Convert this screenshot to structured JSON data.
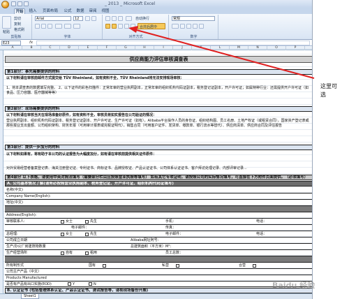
{
  "window": {
    "title": "_ 2013 _ Microsoft Excel"
  },
  "ribbon": {
    "tabs": [
      {
        "label": "开始"
      },
      {
        "label": "插入"
      },
      {
        "label": "页面布局"
      },
      {
        "label": "公式"
      },
      {
        "label": "数据"
      },
      {
        "label": "审阅"
      },
      {
        "label": "视图"
      }
    ],
    "paste_label": "粘贴",
    "cut_label": "剪切",
    "copy_label": "复制",
    "format_painter_label": "格式刷",
    "font_name": "Arial",
    "font_size": "12",
    "wrap_text_label": "自动换行",
    "merge_center_label": "合并后居中",
    "number_format": "常规",
    "groups": {
      "clipboard": "剪贴板",
      "font": "字体",
      "alignment": "对齐方式",
      "number": "数字"
    },
    "accent_color": "#f6c95a"
  },
  "formula_bar": {
    "name_box": "E23",
    "fx": "fx",
    "value": ""
  },
  "columns": [
    "A",
    "B",
    "C",
    "D",
    "E",
    "F",
    "G",
    "H",
    "I",
    "J",
    "K",
    "L",
    "M",
    "N",
    "O",
    "P"
  ],
  "sheet": {
    "title": "供应商能力评估审核调查表",
    "part1": {
      "header": "第1部分：事先需要提供的材料",
      "line1": "以下材料请在审核前邮件方式提交给 TÜV Rheinland，如有资料不全，TÜV Rheinland将无法安排现场审核：",
      "line2": "1、将本调查表的数据填写完整。   2、以下证件的彩色扫描件：正常年审的营业执照副本，正常年审的组织机构代码证副本，税务登记证副本，开户许可证；如属特种行业：还需提供开户许可证（如食品、压力容器、医疗器械等等）"
    },
    "part2": {
      "header": "第2部分：现场需要提供的材料",
      "line1": "以下材料请在审核当天在现场准备好原件，如有资料不全，审核员将如实报告在公司验证的情况：",
      "line2": "营业执照副本、组织机构代码证副本、税务登记证副本、开户许可证、生产许可证（如有），Alibaba平台操作人员的身份证、组织结构图、员工名册、土地产权证（或租赁合同），国家资产登记表或那些报业支出金额、公司组织架构、财务年报（可用审计报表或完税证明代），销售合同（可用客户证件、发货单、缴款单、银行流水等替代）、供应商清单、供应商合同及评估报告"
    },
    "part3": {
      "header": "第3部分：提供一步加分的材料",
      "line1": "以下材料如果有，将有助于本公司的认证报告为大幅度加分，如有请在审核前提供相关证件原件：",
      "line2": "对外贸易经营者备案登记表、海关注册登记证、专利证书、商标证书、品牌授权证、产品认证证书、公司体系认证证书、客户拜访处理记录、内部评审记录..."
    },
    "part4": {
      "header": "第4部分 以下表格，请使用中英对照法填写（需要部分栏目应按照营业执照等填写）",
      "note": "如有其它专项证明，请按照公司的实际情况填写，可直接在下方附件页面提供。（必须填写）"
    },
    "sectionA": {
      "header": "A. 公司基本情况了解(请务必按照营业执照副本、税务登记证、开户许可证、组织机构代码证填写)",
      "rows": [
        {
          "label": "名称(中文)"
        },
        {
          "label": "Company Name(English):"
        },
        {
          "label": "地址(中文)"
        },
        {
          "label": ""
        },
        {
          "label": "Address(English):"
        },
        {
          "label": "审核联系人:"
        },
        {
          "label": ""
        },
        {
          "label": "总经理:"
        },
        {
          "label": "公司成立日期"
        },
        {
          "label": "生产/办公厂房建筑物数量"
        },
        {
          "label": "生产经营场所"
        },
        {
          "label": ""
        },
        {
          "label": "所有制形式"
        },
        {
          "label": "公司主产产品（中文）"
        },
        {
          "label": "Products Manufactured"
        },
        {
          "label": "是否有产品有出口实施(EOD)"
        },
        {
          "label": ""
        }
      ],
      "female": "女士",
      "male": "先生",
      "mobile": "手机：",
      "phone": "电话：",
      "fax": "传真：",
      "email": "电子邮件：",
      "email2": "电子邮件：",
      "alibaba": "Alibaba网址阿号：",
      "area": "总建筑面积（平方米）M²：",
      "staff": "员工总数：",
      "own": "自有",
      "rent": "租用",
      "state": "国有",
      "private": "私营",
      "joint": "合营",
      "yes": "Y",
      "no": "N"
    },
    "sectionB": {
      "header": "B. 认证证书 (包括管理体系认证、产品认证证书、测试报告等，请视现场备份开展)"
    }
  },
  "sheet_tabs": [
    {
      "label": "Sheet1"
    }
  ],
  "annotation": {
    "text": "这里可选"
  },
  "watermark": "Baidu 经验"
}
